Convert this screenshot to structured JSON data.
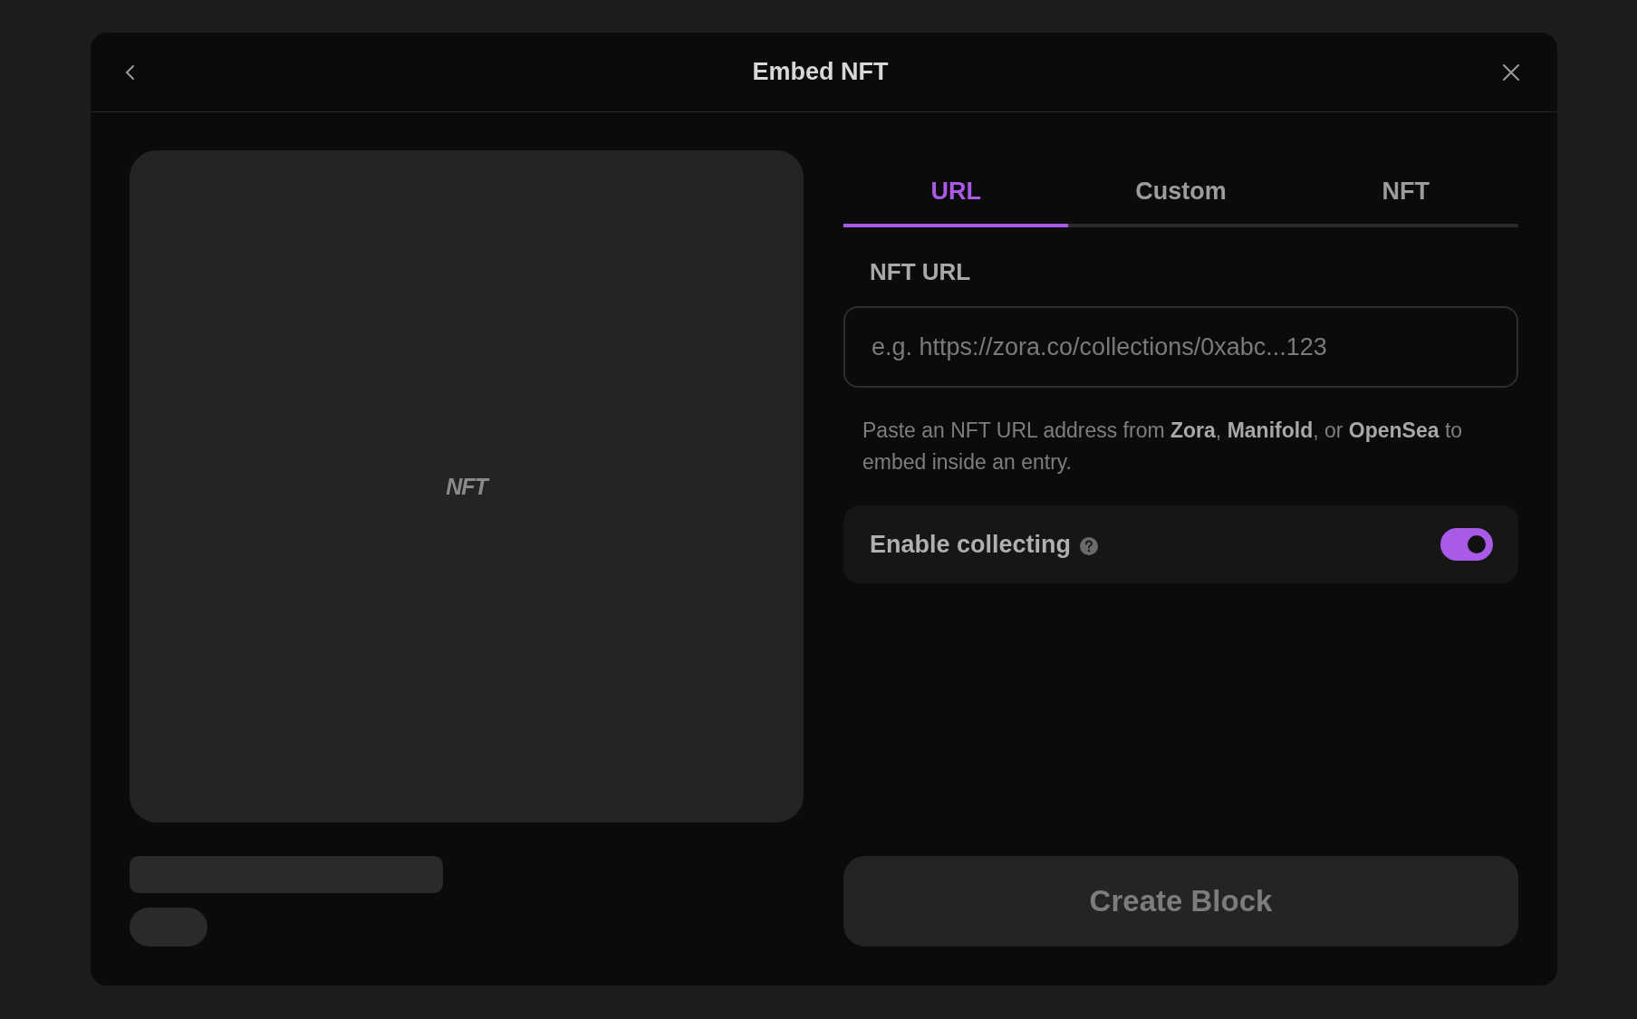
{
  "dialog": {
    "title": "Embed NFT"
  },
  "preview": {
    "label": "NFT"
  },
  "tabs": [
    {
      "label": "URL",
      "selected": true
    },
    {
      "label": "Custom",
      "selected": false
    },
    {
      "label": "NFT",
      "selected": false
    }
  ],
  "url_field": {
    "label": "NFT URL",
    "placeholder": "e.g. https://zora.co/collections/0xabc...123"
  },
  "help_text": "Paste an NFT URL address from **Zora**, **Manifold**, or **OpenSea** to embed inside an entry.",
  "collecting": {
    "label": "Enable collecting",
    "on": true
  },
  "submit": {
    "label": "Create Block",
    "disabled": true
  }
}
